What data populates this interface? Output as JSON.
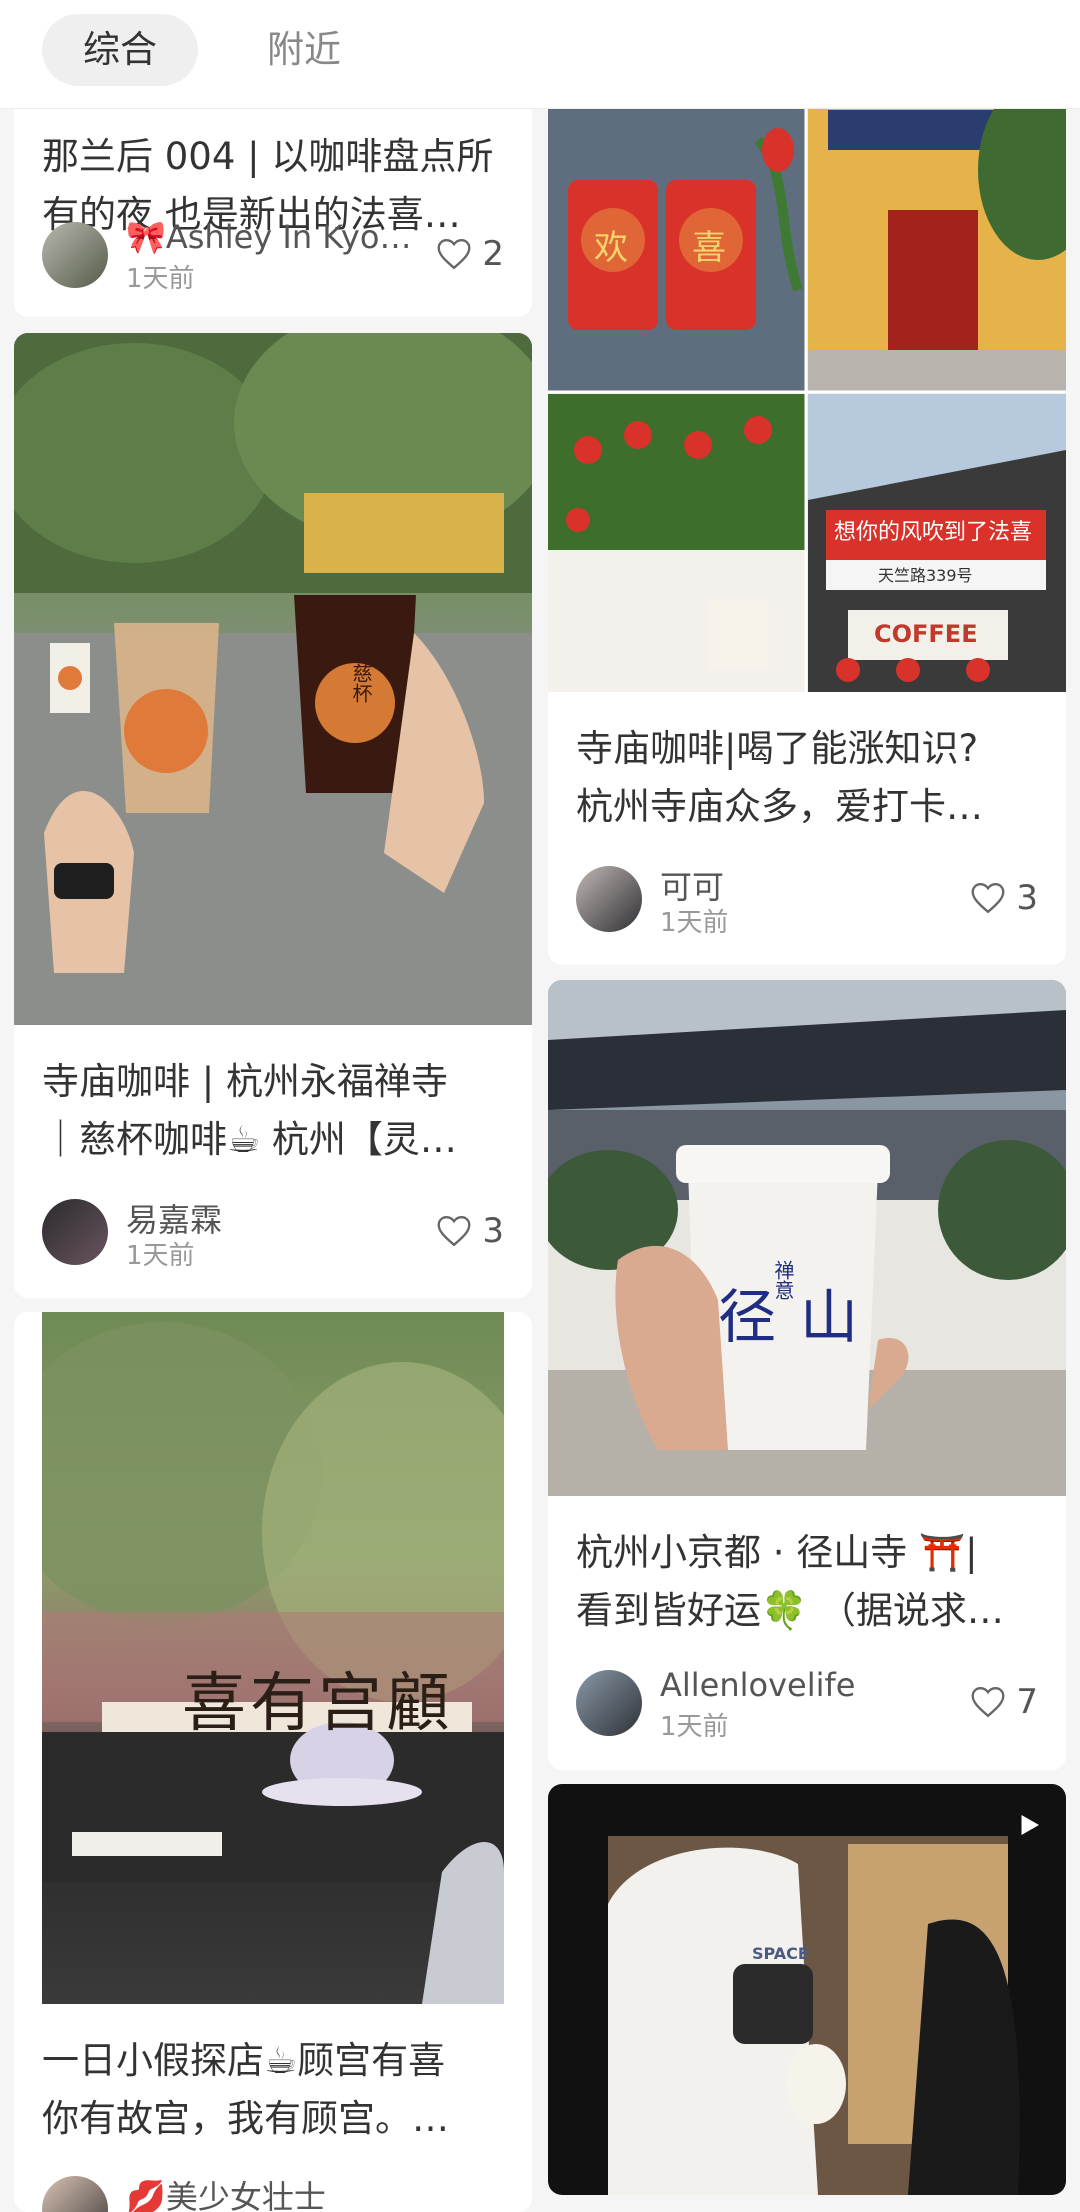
{
  "tabs": [
    {
      "label": "综合",
      "active": true
    },
    {
      "label": "附近",
      "active": false
    }
  ],
  "cards": {
    "c1": {
      "title_lines": [
        "那兰后 004 | 以咖啡盘点所",
        "有的夜 也是新出的法喜…"
      ],
      "author": "🎀Ashley In Kyo…",
      "time": "1天前",
      "likes": "2"
    },
    "c2": {
      "title_lines": [
        "寺庙咖啡 | 杭州永福禅寺",
        "｜慈杯咖啡☕ 杭州【灵…"
      ],
      "author": "易嘉霖",
      "time": "1天前",
      "likes": "3"
    },
    "c3": {
      "title_lines": [
        "一日小假探店☕顾宫有喜",
        "你有故宫，我有顾宫。…"
      ],
      "author": "💋美少女壮士",
      "time": "",
      "likes": ""
    },
    "c4": {
      "image_texts": [
        "想你的风吹到了法喜",
        "天竺路339号",
        "COFFEE",
        "欢",
        "喜"
      ],
      "title_lines": [
        "寺庙咖啡|喝了能涨知识?",
        "杭州寺庙众多，爱打卡…"
      ],
      "author": "可可",
      "time": "1天前",
      "likes": "3"
    },
    "c5": {
      "image_texts": [
        "径山",
        "禅意"
      ],
      "title_lines": [
        "杭州小京都 · 径山寺 ⛩️|",
        "看到皆好运🍀 （据说求…"
      ],
      "author": "Allenlovelife",
      "time": "1天前",
      "likes": "7"
    },
    "c6": {
      "image_texts": [
        "SPACE"
      ]
    }
  },
  "c2_image_texts": [
    "慈杯"
  ],
  "c3_image_texts": [
    "喜有宫顧"
  ],
  "colors": {
    "background": "#f5f5f5",
    "card": "#ffffff",
    "tab_active_bg": "#efefef"
  }
}
